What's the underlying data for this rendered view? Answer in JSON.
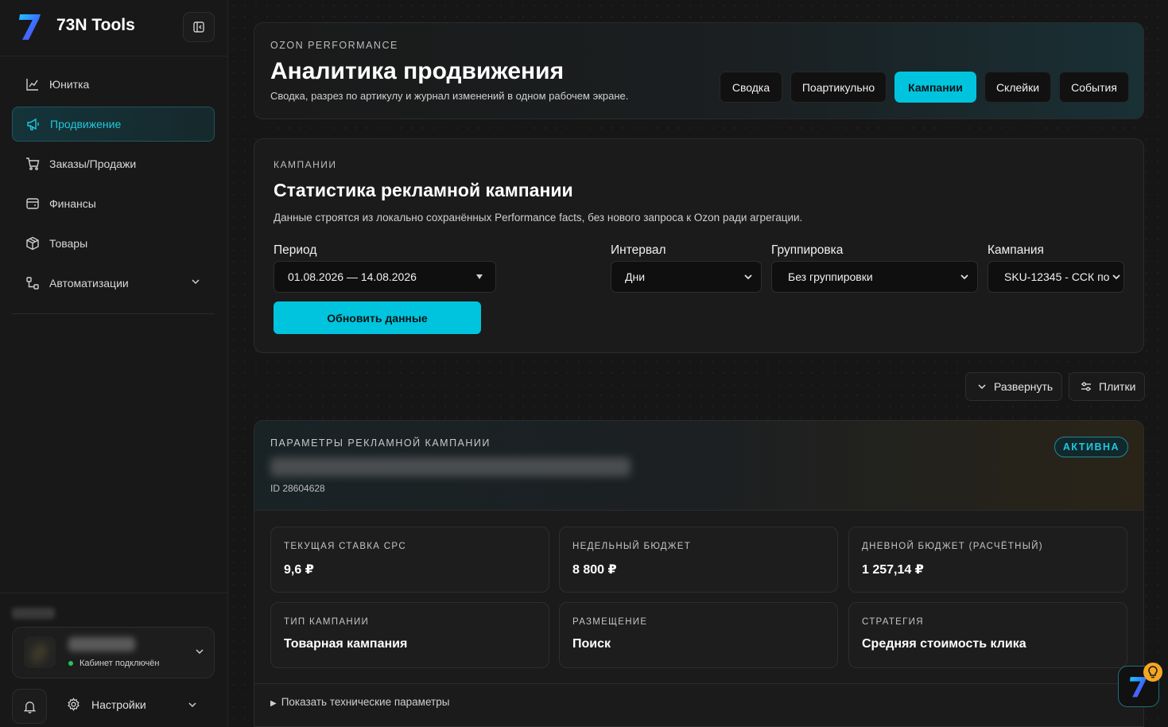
{
  "app": {
    "title": "73N Tools"
  },
  "sidebar": {
    "items": [
      {
        "label": "Юнитка",
        "icon": "chart-line-icon"
      },
      {
        "label": "Продвижение",
        "icon": "megaphone-icon",
        "active": true
      },
      {
        "label": "Заказы/Продажи",
        "icon": "cart-icon"
      },
      {
        "label": "Финансы",
        "icon": "wallet-icon"
      },
      {
        "label": "Товары",
        "icon": "box-icon"
      },
      {
        "label": "Автоматизации",
        "icon": "workflow-icon",
        "expandable": true
      }
    ],
    "account": {
      "status": "Кабинет подключён"
    },
    "settings_label": "Настройки"
  },
  "hero": {
    "kicker": "OZON PERFORMANCE",
    "title": "Аналитика продвижения",
    "subtitle": "Сводка, разрез по артикулу и журнал изменений в одном рабочем экране.",
    "tabs": [
      {
        "label": "Сводка"
      },
      {
        "label": "Поартикульно"
      },
      {
        "label": "Кампании",
        "active": true
      },
      {
        "label": "Склейки"
      },
      {
        "label": "События"
      }
    ]
  },
  "filters": {
    "kicker": "КАМПАНИИ",
    "title": "Статистика рекламной кампании",
    "description": "Данные строятся из локально сохранённых Performance facts, без нового запроса к Ozon ради агрегации.",
    "period_label": "Период",
    "period_value": "01.08.2026 — 14.08.2026",
    "interval_label": "Интервал",
    "interval_value": "Дни",
    "grouping_label": "Группировка",
    "grouping_value": "Без группировки",
    "campaign_label": "Кампания",
    "campaign_value": "SKU-12345 - ССК по",
    "refresh_label": "Обновить данные"
  },
  "toolbar": {
    "expand_label": "Развернуть",
    "tiles_label": "Плитки"
  },
  "campaign": {
    "kicker": "ПАРАМЕТРЫ РЕКЛАМНОЙ КАМПАНИИ",
    "id": "ID 28604628",
    "status": "АКТИВНА",
    "cards": [
      {
        "label": "ТЕКУЩАЯ СТАВКА CPC",
        "value": "9,6 ₽"
      },
      {
        "label": "НЕДЕЛЬНЫЙ БЮДЖЕТ",
        "value": "8 800 ₽"
      },
      {
        "label": "ДНЕВНОЙ БЮДЖЕТ (РАСЧЁТНЫЙ)",
        "value": "1 257,14 ₽"
      },
      {
        "label": "ТИП КАМПАНИИ",
        "value": "Товарная кампания"
      },
      {
        "label": "РАЗМЕЩЕНИЕ",
        "value": "Поиск"
      },
      {
        "label": "СТРАТЕГИЯ",
        "value": "Средняя стоимость клика"
      }
    ],
    "tech_toggle": "Показать технические параметры"
  },
  "colors": {
    "accent": "#00c4dd",
    "status_ok": "#22c55e",
    "helper_bulb": "#f5a623"
  }
}
